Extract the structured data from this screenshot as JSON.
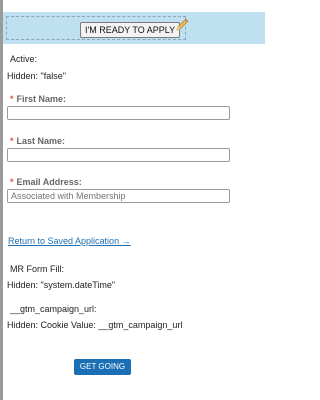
{
  "top_bar": {
    "ready_button": "I'M READY TO APPLY",
    "edit_icon": "pencil-icon"
  },
  "hidden_fields": {
    "active_label": "Active:",
    "active_value": "Hidden: \"false\"",
    "mr_form_fill_label": "MR Form Fill:",
    "mr_form_fill_value": "Hidden: \"system.dateTime\"",
    "gtm_label": "__gtm_campaign_url:",
    "gtm_value": "Hidden: Cookie Value: __gtm_campaign_url"
  },
  "form": {
    "first_name": {
      "label": "First Name:",
      "value": ""
    },
    "last_name": {
      "label": "Last Name:",
      "value": ""
    },
    "email": {
      "label": "Email Address:",
      "placeholder": "Associated with Membership"
    },
    "required_marker": "*"
  },
  "links": {
    "return_saved": "Return to Saved Application →"
  },
  "actions": {
    "get_going": "GET GOING"
  },
  "colors": {
    "band": "#bfe0f1",
    "link": "#1f6fb2",
    "button": "#1a6fb5",
    "required": "#d9534f"
  }
}
